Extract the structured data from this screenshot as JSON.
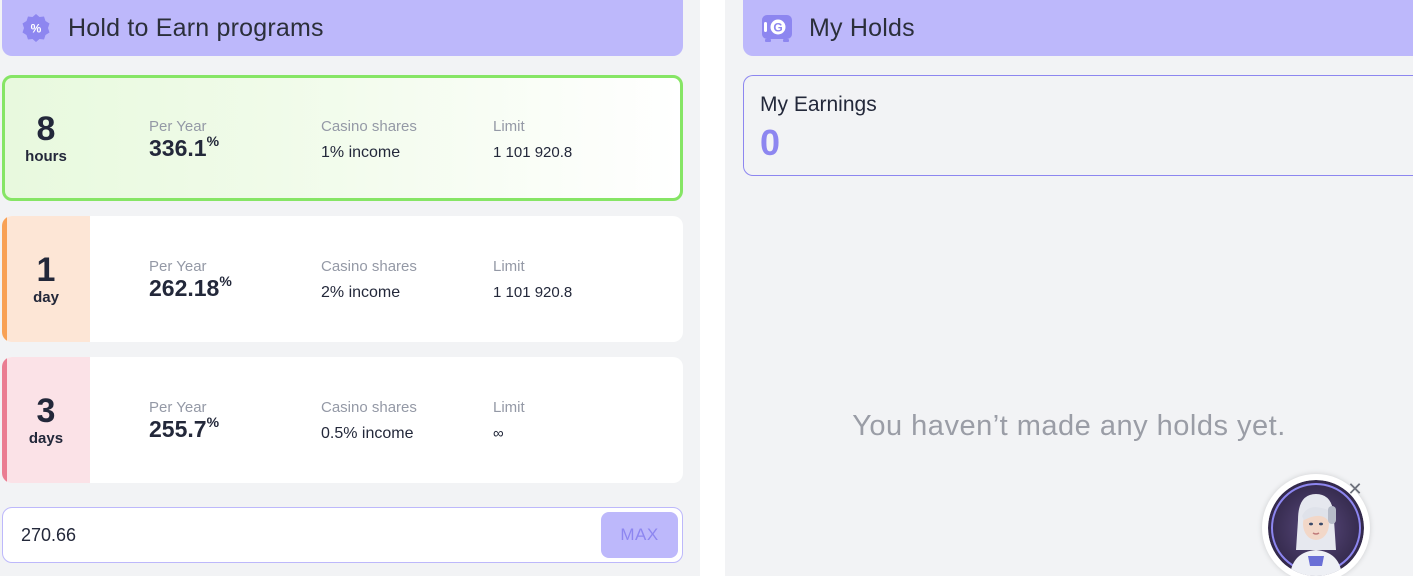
{
  "programs": {
    "title": "Hold to Earn programs",
    "icon": "percent-badge-icon",
    "items": [
      {
        "term_num": "8",
        "term_unit": "hours",
        "per_year_label": "Per Year",
        "rate": "336.1",
        "rate_unit": "%",
        "shares_label": "Casino shares",
        "shares_value": "1% income",
        "limit_label": "Limit",
        "limit_value": "1 101 920.8",
        "selected": true,
        "stripe_color": "#86e565",
        "term_bg": "transparent"
      },
      {
        "term_num": "1",
        "term_unit": "day",
        "per_year_label": "Per Year",
        "rate": "262.18",
        "rate_unit": "%",
        "shares_label": "Casino shares",
        "shares_value": "2% income",
        "limit_label": "Limit",
        "limit_value": "1 101 920.8",
        "selected": false,
        "stripe_color": "#f8a155",
        "term_bg": "#fde6d6"
      },
      {
        "term_num": "3",
        "term_unit": "days",
        "per_year_label": "Per Year",
        "rate": "255.7",
        "rate_unit": "%",
        "shares_label": "Casino shares",
        "shares_value": "0.5% income",
        "limit_label": "Limit",
        "limit_value": "∞",
        "selected": false,
        "stripe_color": "#ea7d92",
        "term_bg": "#fbe2e7"
      }
    ],
    "amount_value": "270.66",
    "max_label": "MAX"
  },
  "holds": {
    "title": "My Holds",
    "icon": "safe-coin-icon",
    "earnings_label": "My Earnings",
    "earnings_value": "0",
    "empty_message": "You haven’t made any holds yet."
  },
  "colors": {
    "accent": "#bdb8fb",
    "accent_dark": "#8d86f0",
    "selected_border": "#86e565"
  }
}
